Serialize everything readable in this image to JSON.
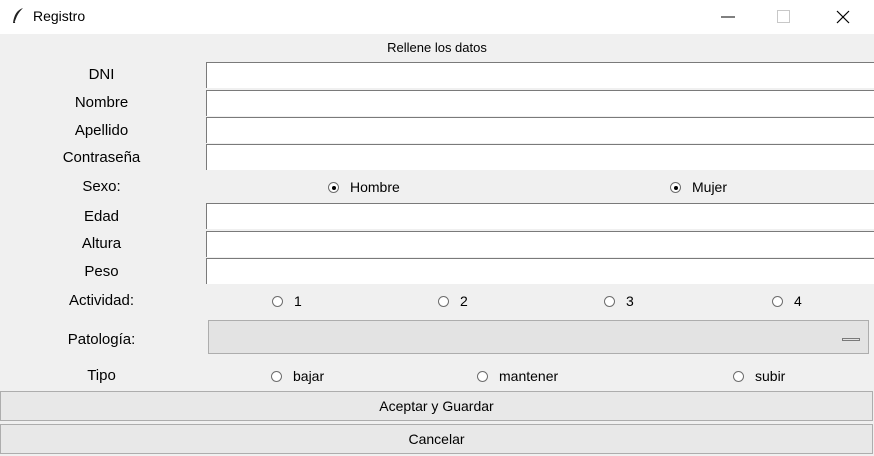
{
  "window": {
    "title": "Registro"
  },
  "header": {
    "label": "Rellene los datos"
  },
  "fields": {
    "dni": {
      "label": "DNI",
      "value": ""
    },
    "nombre": {
      "label": "Nombre",
      "value": ""
    },
    "apellido": {
      "label": "Apellido",
      "value": ""
    },
    "contrasena": {
      "label": "Contraseña",
      "value": ""
    },
    "edad": {
      "label": "Edad",
      "value": ""
    },
    "altura": {
      "label": "Altura",
      "value": ""
    },
    "peso": {
      "label": "Peso",
      "value": ""
    }
  },
  "sexo": {
    "label": "Sexo:",
    "options": [
      "Hombre",
      "Mujer"
    ]
  },
  "actividad": {
    "label": "Actividad:",
    "options": [
      "1",
      "2",
      "3",
      "4"
    ]
  },
  "patologia": {
    "label": "Patología:",
    "value": ""
  },
  "tipo": {
    "label": "Tipo",
    "options": [
      "bajar",
      "mantener",
      "subir"
    ]
  },
  "buttons": {
    "save": "Aceptar y Guardar",
    "cancel": "Cancelar"
  }
}
